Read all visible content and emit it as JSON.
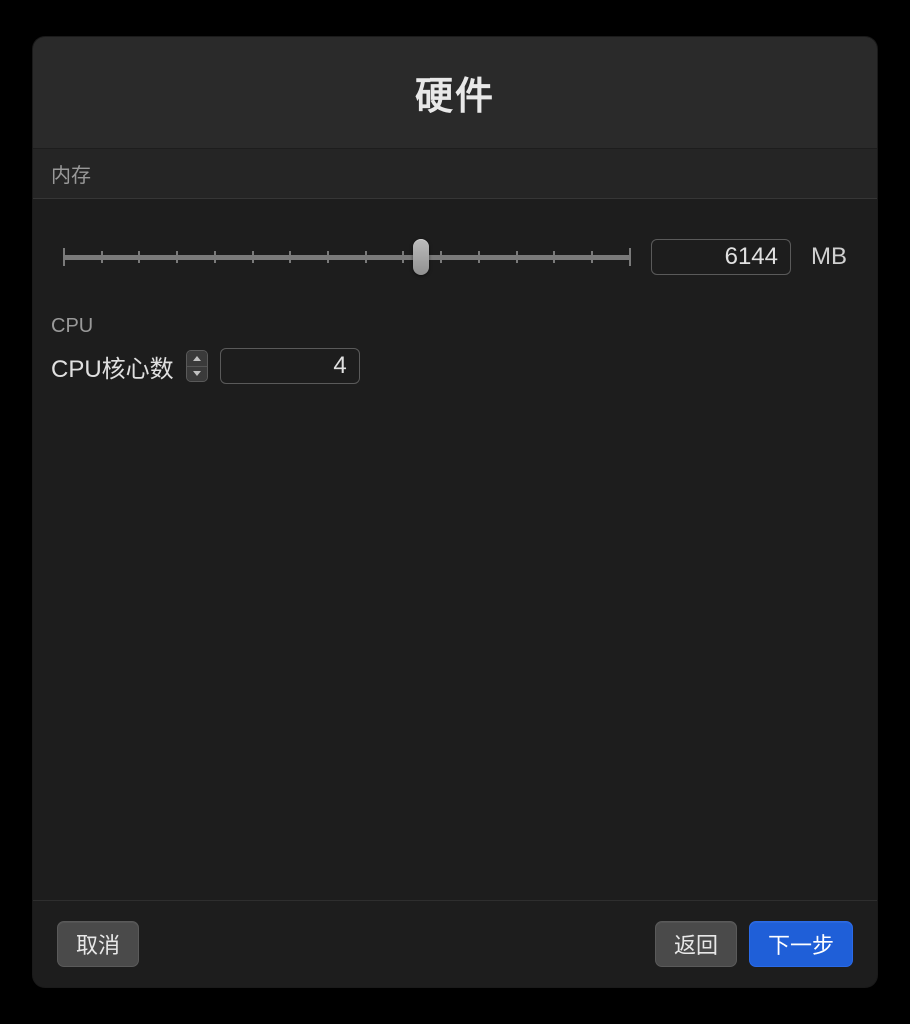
{
  "header": {
    "title": "硬件"
  },
  "memory": {
    "section_label": "内存",
    "value": "6144",
    "unit": "MB",
    "slider_percent": 63
  },
  "cpu": {
    "section_label": "CPU",
    "cores_label": "CPU核心数",
    "cores_value": "4"
  },
  "footer": {
    "cancel": "取消",
    "back": "返回",
    "next": "下一步"
  }
}
